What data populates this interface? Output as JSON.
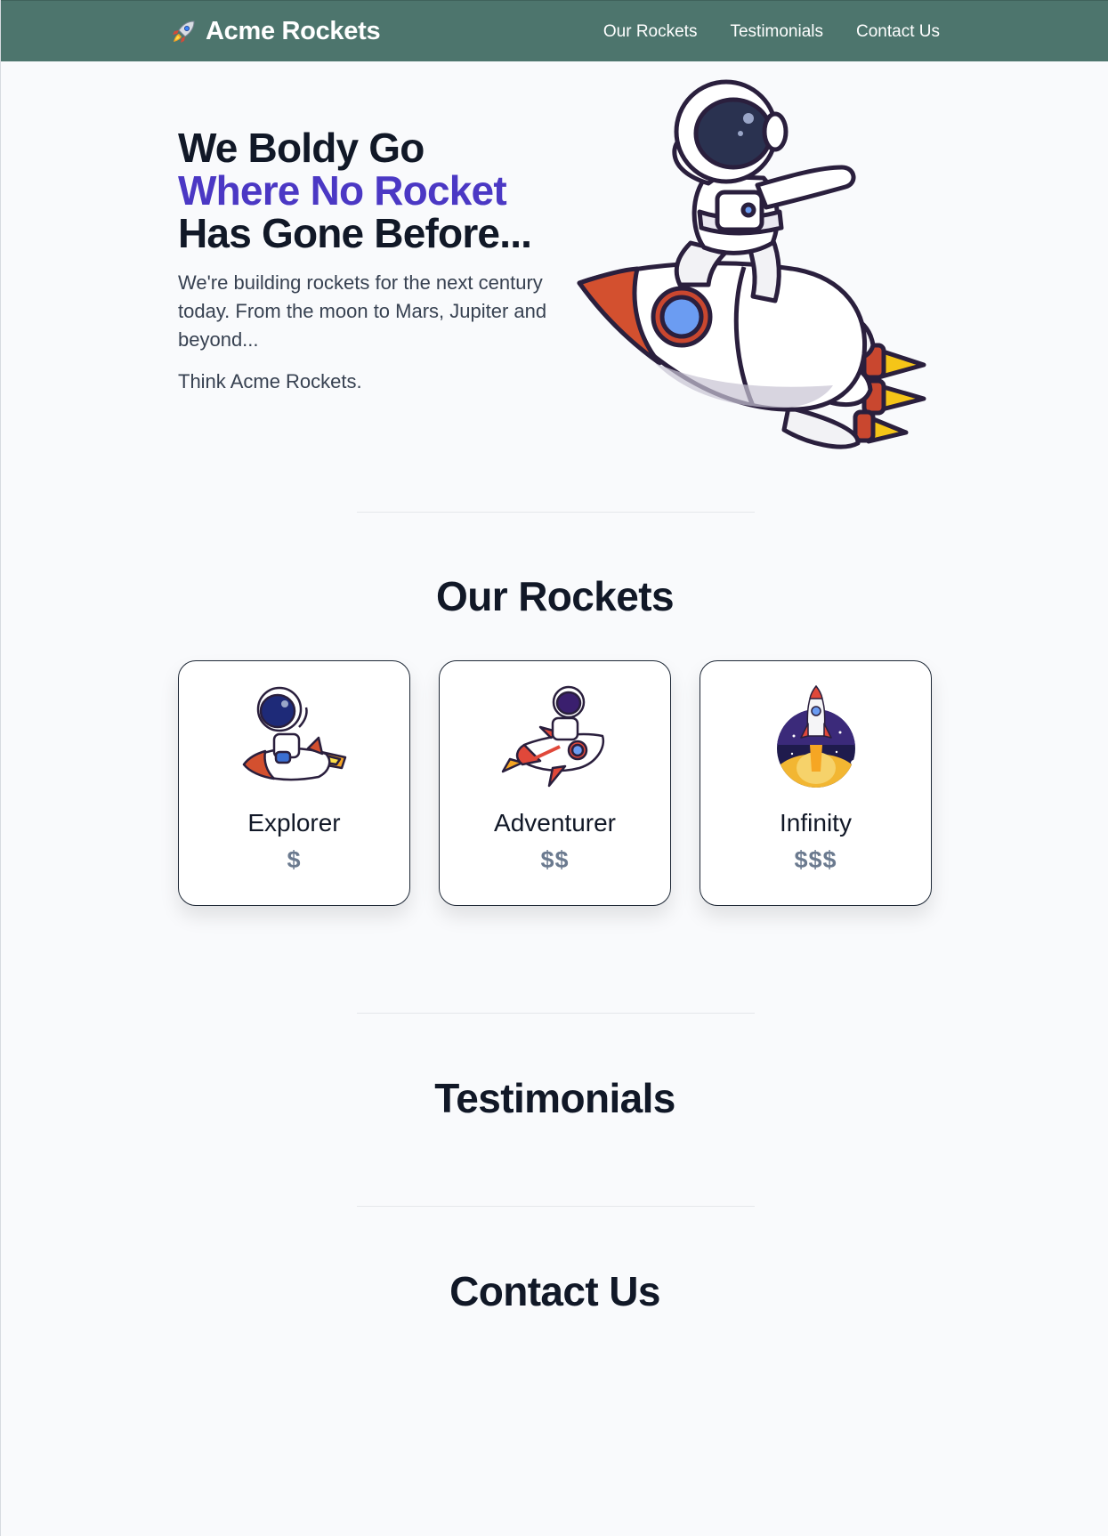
{
  "header": {
    "brand": "Acme Rockets",
    "brand_icon": "rocket-icon",
    "nav": [
      {
        "label": "Our Rockets"
      },
      {
        "label": "Testimonials"
      },
      {
        "label": "Contact Us"
      }
    ]
  },
  "hero": {
    "title_line1": "We Boldy Go",
    "title_line2": "Where No Rocket",
    "title_line3": "Has Gone Before...",
    "description": "We're building rockets for the next century today. From the moon to Mars, Jupiter and beyond...",
    "tagline": "Think Acme Rockets.",
    "image": "astronaut-on-rocket-illustration"
  },
  "sections": {
    "rockets_title": "Our Rockets",
    "testimonials_title": "Testimonials",
    "contact_title": "Contact Us"
  },
  "rockets": [
    {
      "name": "Explorer",
      "price": "$",
      "image": "astronaut-riding-rocket-icon"
    },
    {
      "name": "Adventurer",
      "price": "$$",
      "image": "astronaut-on-red-rocket-icon"
    },
    {
      "name": "Infinity",
      "price": "$$$",
      "image": "rocket-launch-icon"
    }
  ],
  "colors": {
    "header_bg": "#4d756d",
    "accent": "#4b38c4",
    "price": "#6b7a8f",
    "page_bg": "#f9fafc"
  }
}
